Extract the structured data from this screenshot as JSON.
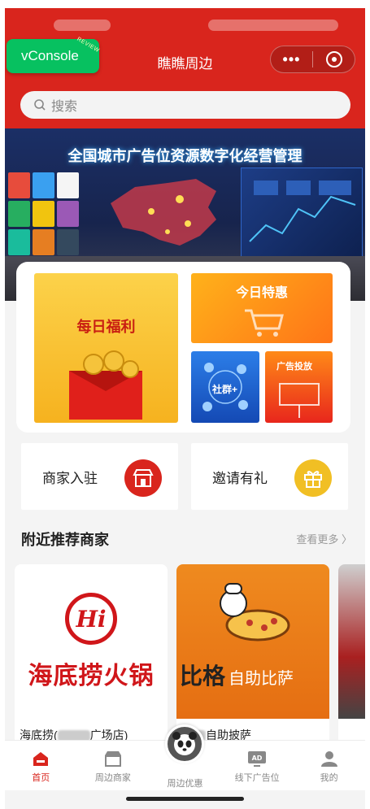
{
  "header": {
    "title": "瞧瞧周边",
    "vconsole_label": "vConsole",
    "vconsole_tag": "REVIEW",
    "more_glyph": "•••",
    "search_placeholder": "搜索"
  },
  "banner": {
    "headline": "全国城市广告位资源数字化经营管理"
  },
  "promo": {
    "daily": "每日福利",
    "today": "今日特惠",
    "social": "社群+",
    "ad": "广告投放"
  },
  "entries": {
    "merchant": "商家入驻",
    "invite": "邀请有礼"
  },
  "nearby": {
    "title": "附近推荐商家",
    "more": "查看更多"
  },
  "merchants": [
    {
      "logo_text": "Hi",
      "sign_text": "海底捞火锅",
      "name_prefix": "海底捞(",
      "name_suffix": "广场店)"
    },
    {
      "sign_text": "比格",
      "sign_sub": "自助比萨",
      "name": "自助披萨"
    }
  ],
  "tabs": [
    {
      "label": "首页",
      "icon": "home-icon"
    },
    {
      "label": "周边商家",
      "icon": "store-icon"
    },
    {
      "label": "周边优惠",
      "icon": "panda-icon"
    },
    {
      "label": "线下广告位",
      "icon": "ad-icon"
    },
    {
      "label": "我的",
      "icon": "user-icon"
    }
  ],
  "colors": {
    "brand": "#d9251d",
    "vconsole": "#07c160",
    "gift": "#f1bf24"
  }
}
